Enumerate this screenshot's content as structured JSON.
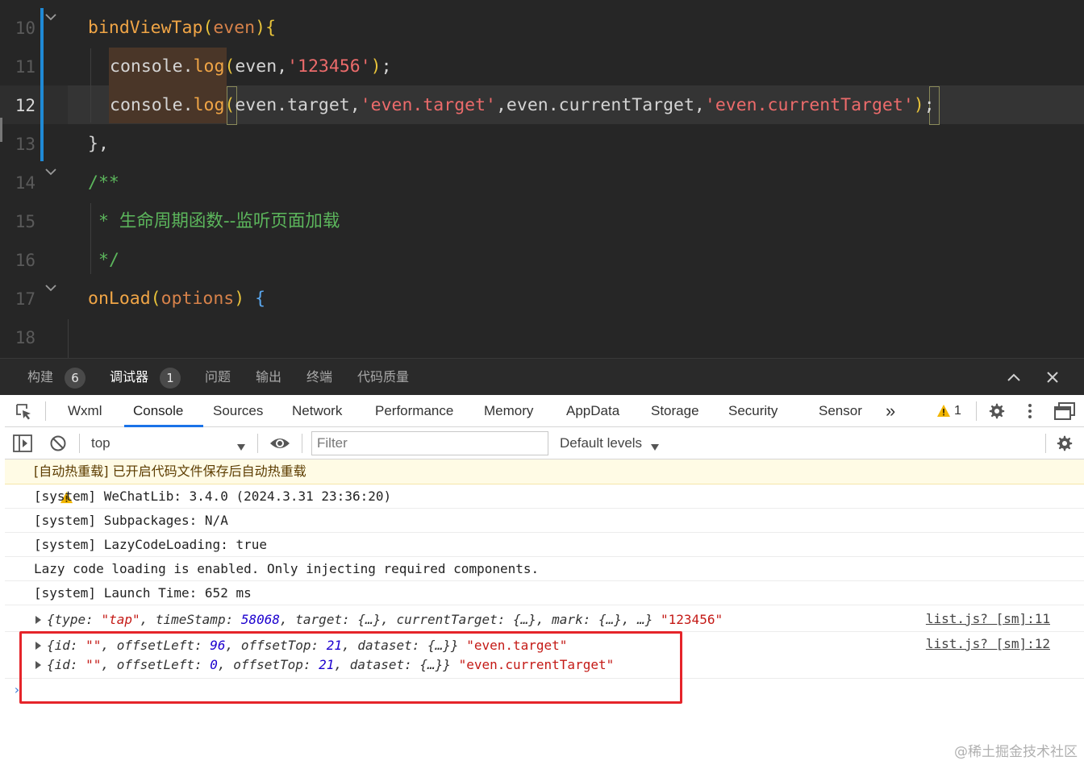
{
  "editor": {
    "lines": [
      {
        "num": "10",
        "parts": [
          [
            "t-fn",
            "bindViewTap"
          ],
          [
            "t-paren",
            "("
          ],
          [
            "t-param",
            "even"
          ],
          [
            "t-paren",
            ")"
          ],
          [
            "t-paren",
            "{"
          ]
        ]
      },
      {
        "num": "11",
        "parts": [
          [
            "t-plain",
            "console."
          ],
          [
            "t-fn",
            "log"
          ],
          [
            "t-paren",
            "("
          ],
          [
            "t-plain",
            "even,"
          ],
          [
            "t-str",
            "'123456'"
          ],
          [
            "t-paren",
            ")"
          ],
          [
            "t-plain",
            ";"
          ]
        ]
      },
      {
        "num": "12",
        "parts": [
          [
            "t-plain",
            "console."
          ],
          [
            "t-fn",
            "log"
          ],
          [
            "t-paren",
            "("
          ],
          [
            "t-plain",
            "even.target,"
          ],
          [
            "t-str",
            "'even.target'"
          ],
          [
            "t-plain",
            ",even.currentTarget,"
          ],
          [
            "t-str",
            "'even.currentTarget'"
          ],
          [
            "t-paren",
            ")"
          ],
          [
            "t-plain",
            ";"
          ]
        ]
      },
      {
        "num": "13",
        "parts": [
          [
            "t-plain",
            "},"
          ]
        ]
      },
      {
        "num": "14",
        "parts": [
          [
            "t-cmt",
            "/**"
          ]
        ]
      },
      {
        "num": "15",
        "parts": [
          [
            "t-cmt",
            "* "
          ],
          [
            "t-cmt cjk",
            "生命周期函数--监听页面加载"
          ]
        ]
      },
      {
        "num": "16",
        "parts": [
          [
            "t-cmt",
            "*/"
          ]
        ]
      },
      {
        "num": "17",
        "parts": [
          [
            "t-fn",
            "onLoad"
          ],
          [
            "t-paren",
            "("
          ],
          [
            "t-param",
            "options"
          ],
          [
            "t-paren",
            ")"
          ],
          [
            "t-plain",
            " "
          ],
          [
            "t-brace",
            "{"
          ]
        ]
      },
      {
        "num": "18",
        "parts": []
      }
    ]
  },
  "panel_tabs": {
    "build": "构建",
    "build_count": "6",
    "debugger": "调试器",
    "debugger_count": "1",
    "problems": "问题",
    "output": "输出",
    "terminal": "终端",
    "code_quality": "代码质量"
  },
  "devtools": {
    "tabs": {
      "wxml": "Wxml",
      "console": "Console",
      "sources": "Sources",
      "network": "Network",
      "performance": "Performance",
      "memory": "Memory",
      "appdata": "AppData",
      "storage": "Storage",
      "security": "Security",
      "sensor": "Sensor",
      "more": "»"
    },
    "warning_count": "1",
    "context": "top",
    "filter_placeholder": "Filter",
    "levels": "Default levels"
  },
  "console": {
    "warn_line": "[自动热重载] 已开启代码文件保存后自动热重载",
    "system_lines": [
      "[system] WeChatLib: 3.4.0 (2024.3.31 23:36:20)",
      "[system] Subpackages: N/A",
      "[system] LazyCodeLoading: true",
      "Lazy code loading is enabled. Only injecting required components.",
      "[system] Launch Time: 652 ms"
    ],
    "log1": {
      "open": "{type: ",
      "type": "\"tap\"",
      "c1": ", timeStamp: ",
      "ts": "58068",
      "rest": ", target: {…}, currentTarget: {…}, mark: {…}, …}",
      "label": " \"123456\"",
      "source": "list.js? [sm]:11"
    },
    "log2a": {
      "open": "{id: ",
      "id": "\"\"",
      "c1": ", offsetLeft: ",
      "ol": "96",
      "c2": ", offsetTop: ",
      "ot": "21",
      "rest": ", dataset: {…}}",
      "label": " \"even.target\"",
      "source": "list.js? [sm]:12"
    },
    "log2b": {
      "open": "{id: ",
      "id": "\"\"",
      "c1": ", offsetLeft: ",
      "ol": "0",
      "c2": ", offsetTop: ",
      "ot": "21",
      "rest": ", dataset: {…}}",
      "label": " \"even.currentTarget\""
    },
    "prompt": "›"
  },
  "watermark": "@稀土掘金技术社区",
  "colors": {
    "accent": "#1a73e8",
    "annotation": "#e5242a",
    "editor_bg": "#262626"
  }
}
